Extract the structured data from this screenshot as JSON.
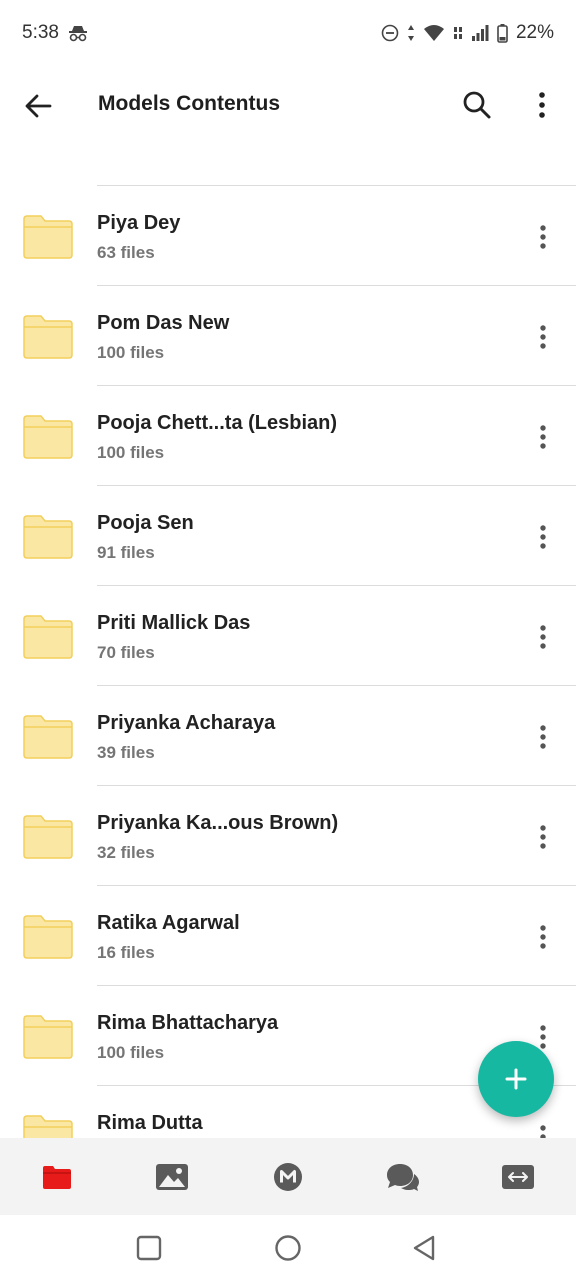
{
  "status": {
    "time": "5:38",
    "battery": "22%"
  },
  "appbar": {
    "title": "Models Contentus"
  },
  "folders": [
    {
      "name": "Piya Dey",
      "count": "63 files"
    },
    {
      "name": "Pom Das New",
      "count": "100 files"
    },
    {
      "name": "Pooja Chett...ta (Lesbian)",
      "count": "100 files"
    },
    {
      "name": "Pooja Sen",
      "count": "91 files"
    },
    {
      "name": "Priti Mallick Das",
      "count": "70 files"
    },
    {
      "name": "Priyanka Acharaya",
      "count": "39 files"
    },
    {
      "name": "Priyanka Ka...ous Brown)",
      "count": "32 files"
    },
    {
      "name": "Ratika Agarwal",
      "count": "16 files"
    },
    {
      "name": "Rima Bhattacharya",
      "count": "100 files"
    },
    {
      "name": "Rima Dutta",
      "count": ""
    }
  ],
  "colors": {
    "accent": "#17b8a2",
    "folder": "#fbe7a4",
    "folder_edge": "#f2cf5c",
    "active_nav": "#e81b1b"
  },
  "bottom_nav": [
    "folder-icon",
    "image-icon",
    "mega-icon",
    "chat-icon",
    "transfer-icon"
  ]
}
